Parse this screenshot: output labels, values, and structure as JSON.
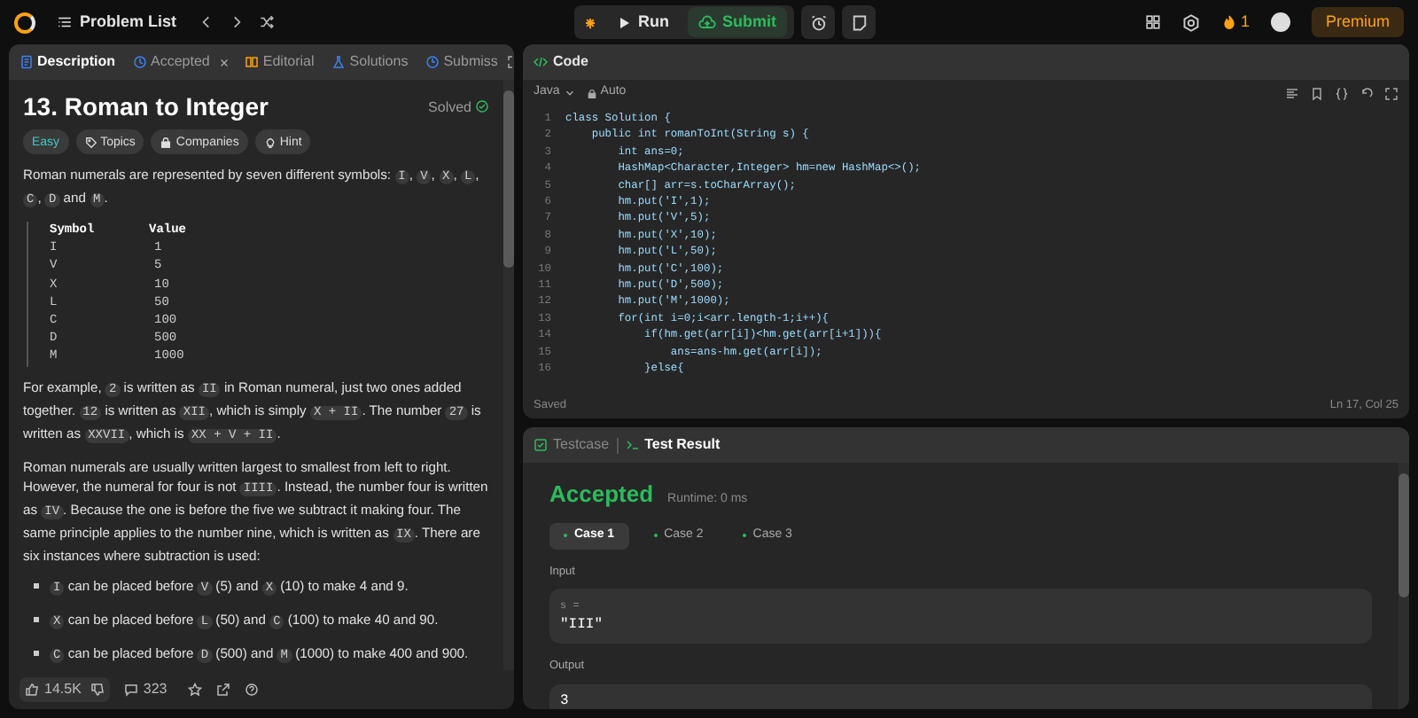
{
  "top_bar": {
    "problem_list": "Problem List",
    "run": "Run",
    "submit": "Submit",
    "streak": "1",
    "premium": "Premium"
  },
  "description_panel": {
    "tabs": [
      {
        "label": "Description",
        "selected": true
      },
      {
        "label": "Accepted",
        "selected": false
      },
      {
        "label": "Editorial",
        "selected": false
      },
      {
        "label": "Solutions",
        "selected": false
      },
      {
        "label": "Submiss",
        "selected": false
      }
    ],
    "title": "13. Roman to Integer",
    "solved": "Solved",
    "tags": [
      {
        "label": "Easy",
        "kind": "difficulty"
      },
      {
        "label": "Topics",
        "kind": "topics"
      },
      {
        "label": "Companies",
        "kind": "companies"
      },
      {
        "label": "Hint",
        "kind": "hint"
      }
    ],
    "intro": [
      {
        "kind": "text",
        "text": "Roman numerals are represented by seven different symbols: "
      },
      {
        "kind": "code",
        "text": "I"
      },
      {
        "kind": "text",
        "text": ", "
      },
      {
        "kind": "code",
        "text": "V"
      },
      {
        "kind": "text",
        "text": ", "
      },
      {
        "kind": "code",
        "text": "X"
      },
      {
        "kind": "text",
        "text": ", "
      },
      {
        "kind": "code",
        "text": "L"
      },
      {
        "kind": "text",
        "text": ", "
      },
      {
        "kind": "code",
        "text": "C"
      },
      {
        "kind": "text",
        "text": ", "
      },
      {
        "kind": "code",
        "text": "D"
      },
      {
        "kind": "text",
        "text": " and "
      },
      {
        "kind": "code",
        "text": "M"
      },
      {
        "kind": "text",
        "text": "."
      }
    ],
    "symbol_table": {
      "columns": [
        "Symbol",
        "Value"
      ],
      "rows": [
        [
          "I",
          "1"
        ],
        [
          "V",
          "5"
        ],
        [
          "X",
          "10"
        ],
        [
          "L",
          "50"
        ],
        [
          "C",
          "100"
        ],
        [
          "D",
          "500"
        ],
        [
          "M",
          "1000"
        ]
      ]
    },
    "paragraphs": [
      [
        {
          "kind": "text",
          "text": "For example, "
        },
        {
          "kind": "code",
          "text": "2"
        },
        {
          "kind": "text",
          "text": " is written as "
        },
        {
          "kind": "code",
          "text": "II"
        },
        {
          "kind": "text",
          "text": " in Roman numeral, just two ones added together. "
        },
        {
          "kind": "code",
          "text": "12"
        },
        {
          "kind": "text",
          "text": " is written as "
        },
        {
          "kind": "code",
          "text": "XII"
        },
        {
          "kind": "text",
          "text": ", which is simply "
        },
        {
          "kind": "code",
          "text": "X + II"
        },
        {
          "kind": "text",
          "text": ". The number "
        },
        {
          "kind": "code",
          "text": "27"
        },
        {
          "kind": "text",
          "text": " is written as "
        },
        {
          "kind": "code",
          "text": "XXVII"
        },
        {
          "kind": "text",
          "text": ", which is "
        },
        {
          "kind": "code",
          "text": "XX + V + II"
        },
        {
          "kind": "text",
          "text": "."
        }
      ],
      [
        {
          "kind": "text",
          "text": "Roman numerals are usually written largest to smallest from left to right. However, the numeral for four is not "
        },
        {
          "kind": "code",
          "text": "IIII"
        },
        {
          "kind": "text",
          "text": ". Instead, the number four is written as "
        },
        {
          "kind": "code",
          "text": "IV"
        },
        {
          "kind": "text",
          "text": ". Because the one is before the five we subtract it making four. The same principle applies to the number nine, which is written as "
        },
        {
          "kind": "code",
          "text": "IX"
        },
        {
          "kind": "text",
          "text": ". There are six instances where subtraction is used:"
        }
      ]
    ],
    "bullets": [
      [
        {
          "kind": "code",
          "text": "I"
        },
        {
          "kind": "text",
          "text": " can be placed before "
        },
        {
          "kind": "code",
          "text": "V"
        },
        {
          "kind": "text",
          "text": " (5) and "
        },
        {
          "kind": "code",
          "text": "X"
        },
        {
          "kind": "text",
          "text": " (10) to make 4 and 9."
        }
      ],
      [
        {
          "kind": "code",
          "text": "X"
        },
        {
          "kind": "text",
          "text": " can be placed before "
        },
        {
          "kind": "code",
          "text": "L"
        },
        {
          "kind": "text",
          "text": " (50) and "
        },
        {
          "kind": "code",
          "text": "C"
        },
        {
          "kind": "text",
          "text": " (100) to make 40 and 90."
        }
      ],
      [
        {
          "kind": "code",
          "text": "C"
        },
        {
          "kind": "text",
          "text": " can be placed before "
        },
        {
          "kind": "code",
          "text": "D"
        },
        {
          "kind": "text",
          "text": " (500) and "
        },
        {
          "kind": "code",
          "text": "M"
        },
        {
          "kind": "text",
          "text": " (1000) to make 400 and 900."
        }
      ]
    ],
    "likes": "14.5K",
    "comments": "323"
  },
  "code_panel": {
    "title": "Code",
    "language": "Java",
    "mode": "Auto",
    "lines": [
      {
        "number": "1",
        "code": "class Solution {"
      },
      {
        "number": "2",
        "code": "    public int romanToInt(String s) {"
      },
      {
        "number": "3",
        "code": "        int ans=0;"
      },
      {
        "number": "4",
        "code": "        HashMap<Character,Integer> hm=new HashMap<>();"
      },
      {
        "number": "5",
        "code": "        char[] arr=s.toCharArray();"
      },
      {
        "number": "6",
        "code": "        hm.put('I',1);"
      },
      {
        "number": "7",
        "code": "        hm.put('V',5);"
      },
      {
        "number": "8",
        "code": "        hm.put('X',10);"
      },
      {
        "number": "9",
        "code": "        hm.put('L',50);"
      },
      {
        "number": "10",
        "code": "        hm.put('C',100);"
      },
      {
        "number": "11",
        "code": "        hm.put('D',500);"
      },
      {
        "number": "12",
        "code": "        hm.put('M',1000);"
      },
      {
        "number": "13",
        "code": "        for(int i=0;i<arr.length-1;i++){"
      },
      {
        "number": "14",
        "code": "            if(hm.get(arr[i])<hm.get(arr[i+1])){"
      },
      {
        "number": "15",
        "code": "                ans=ans-hm.get(arr[i]);"
      },
      {
        "number": "16",
        "code": "            }else{"
      }
    ],
    "status": "Saved",
    "cursor": "Ln 17, Col 25"
  },
  "result_panel": {
    "tabs": [
      {
        "label": "Testcase",
        "selected": false
      },
      {
        "label": "Test Result",
        "selected": true
      }
    ],
    "verdict": "Accepted",
    "runtime": "Runtime: 0 ms",
    "cases": [
      {
        "label": "Case 1",
        "selected": true
      },
      {
        "label": "Case 2",
        "selected": false
      },
      {
        "label": "Case 3",
        "selected": false
      }
    ],
    "input_label": "Input",
    "input_variable": "s =",
    "input_value": "\"III\"",
    "output_label": "Output",
    "output_value": "3"
  }
}
